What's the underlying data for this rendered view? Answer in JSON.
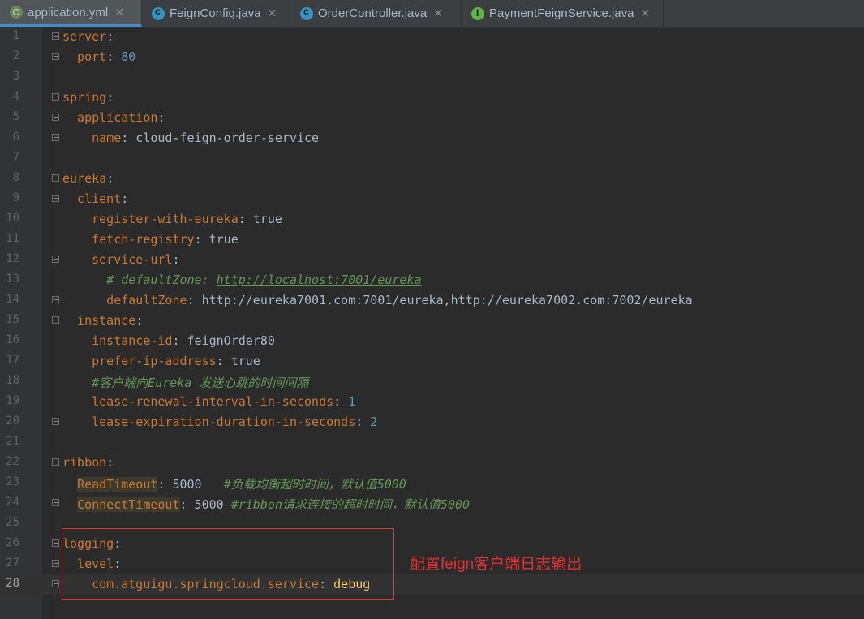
{
  "tabs": [
    {
      "label": "application.yml",
      "icon": "yaml-file-icon",
      "active": true
    },
    {
      "label": "FeignConfig.java",
      "icon": "class-icon",
      "active": false
    },
    {
      "label": "OrderController.java",
      "icon": "class-icon",
      "active": false
    },
    {
      "label": "PaymentFeignService.java",
      "icon": "interface-icon",
      "active": false
    }
  ],
  "close_glyph": "✕",
  "editor": {
    "current_line": 28,
    "lines": [
      {
        "n": "1",
        "k": "server",
        "v": ":"
      },
      {
        "n": "2",
        "k": "  port",
        "v": ": ",
        "num": "80"
      },
      {
        "n": "3"
      },
      {
        "n": "4",
        "k": "spring",
        "v": ":"
      },
      {
        "n": "5",
        "k": "  application",
        "v": ":"
      },
      {
        "n": "6",
        "k": "    name",
        "v": ": cloud-feign-order-service"
      },
      {
        "n": "7"
      },
      {
        "n": "8",
        "k": "eureka",
        "v": ":"
      },
      {
        "n": "9",
        "k": "  client",
        "v": ":"
      },
      {
        "n": "10",
        "k": "    register-with-eureka",
        "v": ": true"
      },
      {
        "n": "11",
        "k": "    fetch-registry",
        "v": ": true"
      },
      {
        "n": "12",
        "k": "    service-url",
        "v": ":"
      },
      {
        "n": "13",
        "c": "      # defaultZone: ",
        "link": "http://localhost:7001/eureka"
      },
      {
        "n": "14",
        "k": "      defaultZone",
        "v": ": http://eureka7001.com:7001/eureka,http://eureka7002.com:7002/eureka"
      },
      {
        "n": "15",
        "k": "  instance",
        "v": ":"
      },
      {
        "n": "16",
        "k": "    instance-id",
        "v": ": feignOrder80"
      },
      {
        "n": "17",
        "k": "    prefer-ip-address",
        "v": ": true"
      },
      {
        "n": "18",
        "c": "    #客户端向Eureka 发送心跳的时间间隔"
      },
      {
        "n": "19",
        "k": "    lease-renewal-interval-in-seconds",
        "v": ": ",
        "num": "1"
      },
      {
        "n": "20",
        "k": "    lease-expiration-duration-in-seconds",
        "v": ": ",
        "num": "2"
      },
      {
        "n": "21"
      },
      {
        "n": "22",
        "k": "ribbon",
        "v": ":"
      },
      {
        "n": "23",
        "kb": "ReadTimeout",
        "v": ": 5000   ",
        "c2": "#负载均衡超时时间，默认值5000"
      },
      {
        "n": "24",
        "kb": "ConnectTimeout",
        "v": ": 5000 ",
        "c2": "#ribbon请求连接的超时时间，默认值5000"
      },
      {
        "n": "25"
      },
      {
        "n": "26",
        "k": "logging",
        "v": ":"
      },
      {
        "n": "27",
        "k": "  level",
        "v": ":"
      },
      {
        "n": "28",
        "k": "    com.atguigu.springcloud.service",
        "v": ": ",
        "hl": "debug"
      }
    ]
  },
  "annotation": "配置feign客户端日志输出"
}
